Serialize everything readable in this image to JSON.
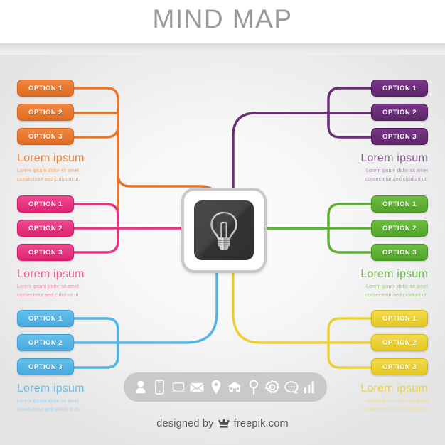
{
  "header": {
    "title": "MIND MAP"
  },
  "center": {
    "icon": "lightbulb-icon"
  },
  "option_label_1": "OPTION 1",
  "option_label_2": "OPTION 2",
  "option_label_3": "OPTION 3",
  "caption_heading": "Lorem ipsum",
  "caption_line1": "Lorem ipsum dolor sit amet",
  "caption_line2": "consectetur aed cididunt ut.",
  "groups": [
    {
      "id": "orange",
      "side": "left",
      "color": "#e8762c",
      "color_dark": "#d2641f",
      "caption_color": "#e8843f",
      "sub_color": "#eda267",
      "options": [
        "OPTION 1",
        "OPTION 2",
        "OPTION 3"
      ],
      "caption": {
        "heading": "Lorem ipsum",
        "line1": "Lorem ipsum dolor sit amet",
        "line2": "consectetur aed cididunt ut."
      }
    },
    {
      "id": "purple",
      "side": "right",
      "color": "#6b2d78",
      "color_dark": "#5a2264",
      "caption_color": "#8a5c93",
      "sub_color": "#a98bb0",
      "options": [
        "OPTION 1",
        "OPTION 2",
        "OPTION 3"
      ],
      "caption": {
        "heading": "Lorem ipsum",
        "line1": "Lorem ipsum dolor sit amet",
        "line2": "consectetur aed cididunt ut."
      }
    },
    {
      "id": "pink",
      "side": "left",
      "color": "#e8317f",
      "color_dark": "#d11f6c",
      "caption_color": "#ec5d9b",
      "sub_color": "#f18cb8",
      "options": [
        "OPTION 1",
        "OPTION 2",
        "OPTION 3"
      ],
      "caption": {
        "heading": "Lorem ipsum",
        "line1": "Lorem ipsum dolor sit amet",
        "line2": "consectetur aed cididunt ut."
      }
    },
    {
      "id": "green",
      "side": "right",
      "color": "#5cb033",
      "color_dark": "#4d9a28",
      "caption_color": "#6cba45",
      "sub_color": "#97cd7c",
      "options": [
        "OPTION 1",
        "OPTION 2",
        "OPTION 3"
      ],
      "caption": {
        "heading": "Lorem ipsum",
        "line1": "Lorem ipsum dolor sit amet",
        "line2": "consectetur aed cididunt ut."
      }
    },
    {
      "id": "blue",
      "side": "left",
      "color": "#53b4e6",
      "color_dark": "#3ba3db",
      "caption_color": "#6cbde8",
      "sub_color": "#9bd2ef",
      "options": [
        "OPTION 1",
        "OPTION 2",
        "OPTION 3"
      ],
      "caption": {
        "heading": "Lorem ipsum",
        "line1": "Lorem ipsum dolor sit amet",
        "line2": "consectetur aed cididunt ut."
      }
    },
    {
      "id": "yellow",
      "side": "right",
      "color": "#ecd031",
      "color_dark": "#dcbd1c",
      "caption_color": "#e9d14a",
      "sub_color": "#efdd86",
      "options": [
        "OPTION 1",
        "OPTION 2",
        "OPTION 3"
      ],
      "caption": {
        "heading": "Lorem ipsum",
        "line1": "Lorem ipsum dolor sit amet",
        "line2": "consectetur aed cididunt ut."
      }
    }
  ],
  "iconbar": {
    "background": "#c9c9c9",
    "icons": [
      "user-icon",
      "smartphone-icon",
      "laptop-icon",
      "envelope-icon",
      "location-pin-icon",
      "house-icon",
      "map-marker-pin-icon",
      "gear-icon",
      "speech-bubble-icon",
      "bar-chart-icon"
    ]
  },
  "footer": {
    "prefix": "designed by",
    "brand": "freepik.com",
    "logo": "crown-icon"
  }
}
